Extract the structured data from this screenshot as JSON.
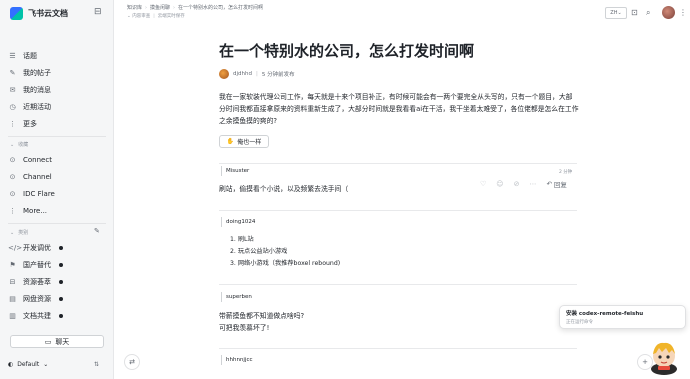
{
  "sidebar": {
    "brand": "飞书云文档",
    "items": [
      {
        "label": "话题",
        "icon": "chat-icon"
      },
      {
        "label": "我的帖子",
        "icon": "post-icon"
      },
      {
        "label": "我的消息",
        "icon": "message-icon"
      },
      {
        "label": "近期活动",
        "icon": "activity-icon"
      },
      {
        "label": "更多",
        "icon": "more-icon"
      }
    ],
    "section1_label": "收藏",
    "links": [
      {
        "label": "Connect",
        "icon": "link-icon"
      },
      {
        "label": "Channel",
        "icon": "link-icon"
      },
      {
        "label": "IDC Flare",
        "icon": "link-icon"
      },
      {
        "label": "More...",
        "icon": "more-icon"
      }
    ],
    "section2_label": "类别",
    "categories": [
      {
        "label": "开发调优",
        "icon": "code-icon"
      },
      {
        "label": "国产替代",
        "icon": "flag-icon"
      },
      {
        "label": "资源荟萃",
        "icon": "resource-icon"
      },
      {
        "label": "网盘资源",
        "icon": "disk-icon"
      },
      {
        "label": "文档共建",
        "icon": "doc-icon"
      }
    ],
    "chat_button": "聊天",
    "theme_label": "Default"
  },
  "topbar": {
    "breadcrumb": [
      "知识库",
      "摸鱼闲聊",
      "在一个特别水的公司，怎么打发时间啊"
    ],
    "sub_breadcrumb": [
      "内容审查",
      "云端实时保存"
    ],
    "lang": "ZH"
  },
  "post": {
    "title": "在一个特别水的公司，怎么打发时间啊",
    "author": "djdhhd",
    "meta": "5 分钟前发布",
    "body": "我在一家软装代理公司工作，每天就是十来个项目补正，有时候可能会有一两个要完全从头写的，只有一个题目，大部分时间我都直接拿原来的资料重新生成了，大部分时间就是我看看ai在干活，我干坐着太难受了，各位佬都是怎么在工作之余摸鱼摸的爽的?",
    "same_button": "俺也一样"
  },
  "comments": [
    {
      "user": "Misuster",
      "time": "2 分钟",
      "text": "刷站，偷摸看个小说，以及频繁去洗手间（"
    },
    {
      "user": "doing1024",
      "list": [
        "刷L站",
        "玩点公益站小游戏",
        "网络小游戏（我推荐boxel rebound)"
      ]
    },
    {
      "user": "superben",
      "lines": [
        "带薪摸鱼都不知道做点啥吗?",
        "可把我羡慕坏了!"
      ]
    },
    {
      "user": "hhhnnjjcc"
    }
  ],
  "reply_label": "回复",
  "toast": {
    "title": "安装 codex-remote-feishu",
    "subtitle": "正在运行命令"
  }
}
